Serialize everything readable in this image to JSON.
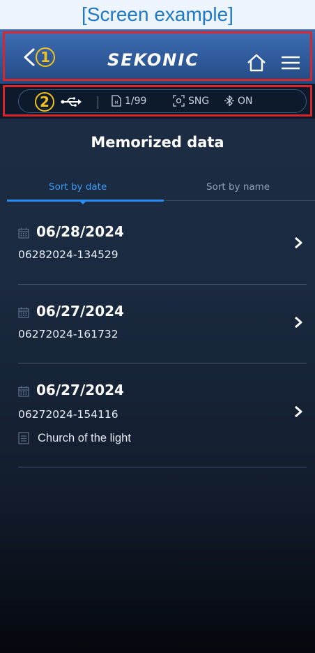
{
  "caption": "[Screen example]",
  "header": {
    "brand": "SEKONIC",
    "callout_1": "1",
    "callout_2": "2"
  },
  "status": {
    "memory": "1/99",
    "mode": "SNG",
    "bluetooth": "ON"
  },
  "page": {
    "title": "Memorized data"
  },
  "tabs": [
    {
      "label": "Sort by date",
      "active": true
    },
    {
      "label": "Sort by name",
      "active": false
    }
  ],
  "items": [
    {
      "date": "06/28/2024",
      "name": "06282024-134529",
      "memo": ""
    },
    {
      "date": "06/27/2024",
      "name": "06272024-161732",
      "memo": ""
    },
    {
      "date": "06/27/2024",
      "name": "06272024-154116",
      "memo": "Church of the light"
    }
  ],
  "colors": {
    "accent": "#2d8cf0",
    "highlight": "#d8262a",
    "callout": "#f2c21b",
    "header_blue": "#3e6fb6"
  },
  "icons": [
    "back-icon",
    "home-icon",
    "menu-icon",
    "usb-icon",
    "memory-card-icon",
    "metering-mode-icon",
    "bluetooth-icon",
    "calendar-icon",
    "chevron-right-icon",
    "memo-icon"
  ]
}
